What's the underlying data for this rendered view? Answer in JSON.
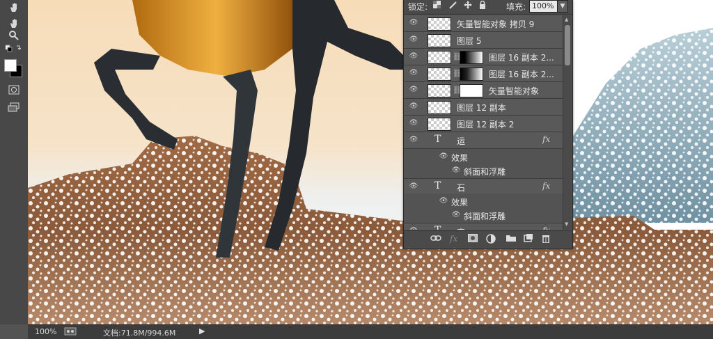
{
  "toolbar": {
    "tools": [
      "hand-tool",
      "zoom-tool",
      "default-colors",
      "swap-colors",
      "quick-mask",
      "screen-mode"
    ]
  },
  "layers_panel": {
    "lock_label": "锁定:",
    "fill_label": "填充:",
    "fill_value": "100%",
    "layers": [
      {
        "name": "矢量智能对象 拷贝 9",
        "type": "smart",
        "visible": true
      },
      {
        "name": "图层 5",
        "type": "pixel",
        "visible": true
      },
      {
        "name": "图层 16 副本 2...",
        "type": "masked",
        "visible": true
      },
      {
        "name": "图层 16 副本 2...",
        "type": "masked",
        "visible": true
      },
      {
        "name": "矢量智能对象",
        "type": "masked",
        "visible": true
      },
      {
        "name": "图层 12 副本",
        "type": "pixel",
        "visible": true
      },
      {
        "name": "图层 12 副本 2",
        "type": "pixel",
        "visible": true
      },
      {
        "name": "运",
        "type": "text",
        "visible": true,
        "fx": "fx"
      },
      {
        "name": "效果",
        "type": "effects",
        "visible": true
      },
      {
        "name": "斜面和浮雕",
        "type": "effect",
        "visible": true
      },
      {
        "name": "石",
        "type": "text",
        "visible": true,
        "fx": "fx"
      },
      {
        "name": "效果",
        "type": "effects",
        "visible": true
      },
      {
        "name": "斜面和浮雕",
        "type": "effect",
        "visible": true
      },
      {
        "name": "来",
        "type": "text",
        "visible": true,
        "fx": "fx"
      }
    ]
  },
  "statusbar": {
    "zoom": "100%",
    "doc_info": "文档:71.8M/994.6M"
  },
  "colors": {
    "panel_bg": "#535353",
    "toolbar_bg": "#484848",
    "foreground": "#ffffff",
    "background": "#000000"
  }
}
